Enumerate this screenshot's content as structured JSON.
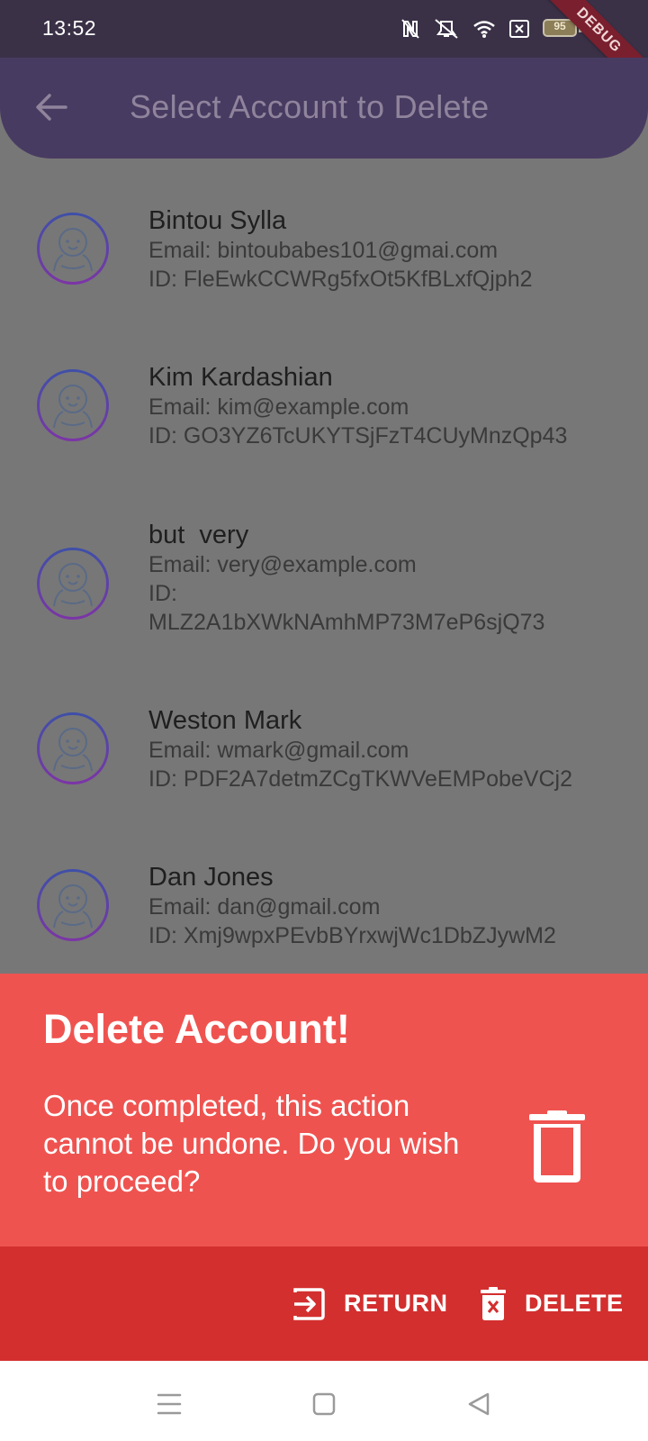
{
  "status_bar": {
    "time": "13:52",
    "battery_level": "95",
    "debug_label": "DEBUG",
    "icons": [
      "nfc-icon",
      "mute-icon",
      "wifi-icon",
      "sim-off-icon",
      "battery-icon",
      "charging-icon"
    ]
  },
  "app_bar": {
    "title": "Select Account to Delete",
    "back_icon": "arrow-left-icon"
  },
  "accounts": [
    {
      "name": "Bintou Sylla",
      "email": "Email:  bintoubabes101@gmai.com",
      "id": "ID: FleEwkCCWRg5fxOt5KfBLxfQjph2"
    },
    {
      "name": "Kim Kardashian",
      "email": "Email: kim@example.com",
      "id": "ID: GO3YZ6TcUKYTSjFzT4CUyMnzQp43"
    },
    {
      "name": "but  very",
      "email": "Email: very@example.com",
      "id_label": "ID:",
      "id_value": "MLZ2A1bXWkNAmhMP73M7eP6sjQ73"
    },
    {
      "name": "Weston Mark",
      "email": "Email: wmark@gmail.com",
      "id": "ID: PDF2A7detmZCgTKWVeEMPobeVCj2"
    },
    {
      "name": "Dan Jones",
      "email": "Email: dan@gmail.com",
      "id": "ID: Xmj9wpxPEvbBYrxwjWc1DbZJywM2"
    }
  ],
  "dialog": {
    "title": "Delete Account!",
    "message": "Once completed, this action cannot be undone. Do you wish to proceed?",
    "icon": "trash-icon",
    "background": "#ef5350"
  },
  "actions": {
    "return_label": "RETURN",
    "delete_label": "DELETE",
    "background": "#d32f2f"
  },
  "nav_bar": {
    "icons": [
      "menu-icon",
      "home-icon",
      "back-triangle-icon"
    ]
  },
  "colors": {
    "app_bar": "#483b61",
    "status_bar": "#3a3147",
    "scrim": "#777777"
  }
}
